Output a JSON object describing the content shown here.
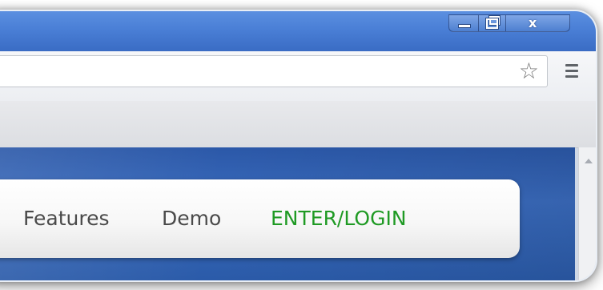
{
  "window": {
    "controls": {
      "minimize": "minimize",
      "restore": "restore",
      "close": "close"
    }
  },
  "toolbar": {
    "address_value": "",
    "bookmark_icon": "star-icon",
    "menu_icon": "hamburger-menu-icon"
  },
  "site_nav": {
    "links": [
      {
        "label": "Features"
      },
      {
        "label": "Demo"
      },
      {
        "label": "ENTER/LOGIN",
        "color": "#1f9a24"
      }
    ]
  },
  "colors": {
    "titlebar": "#4a7fd6",
    "page_background": "#3a6bbd",
    "login_accent": "#1f9a24"
  }
}
